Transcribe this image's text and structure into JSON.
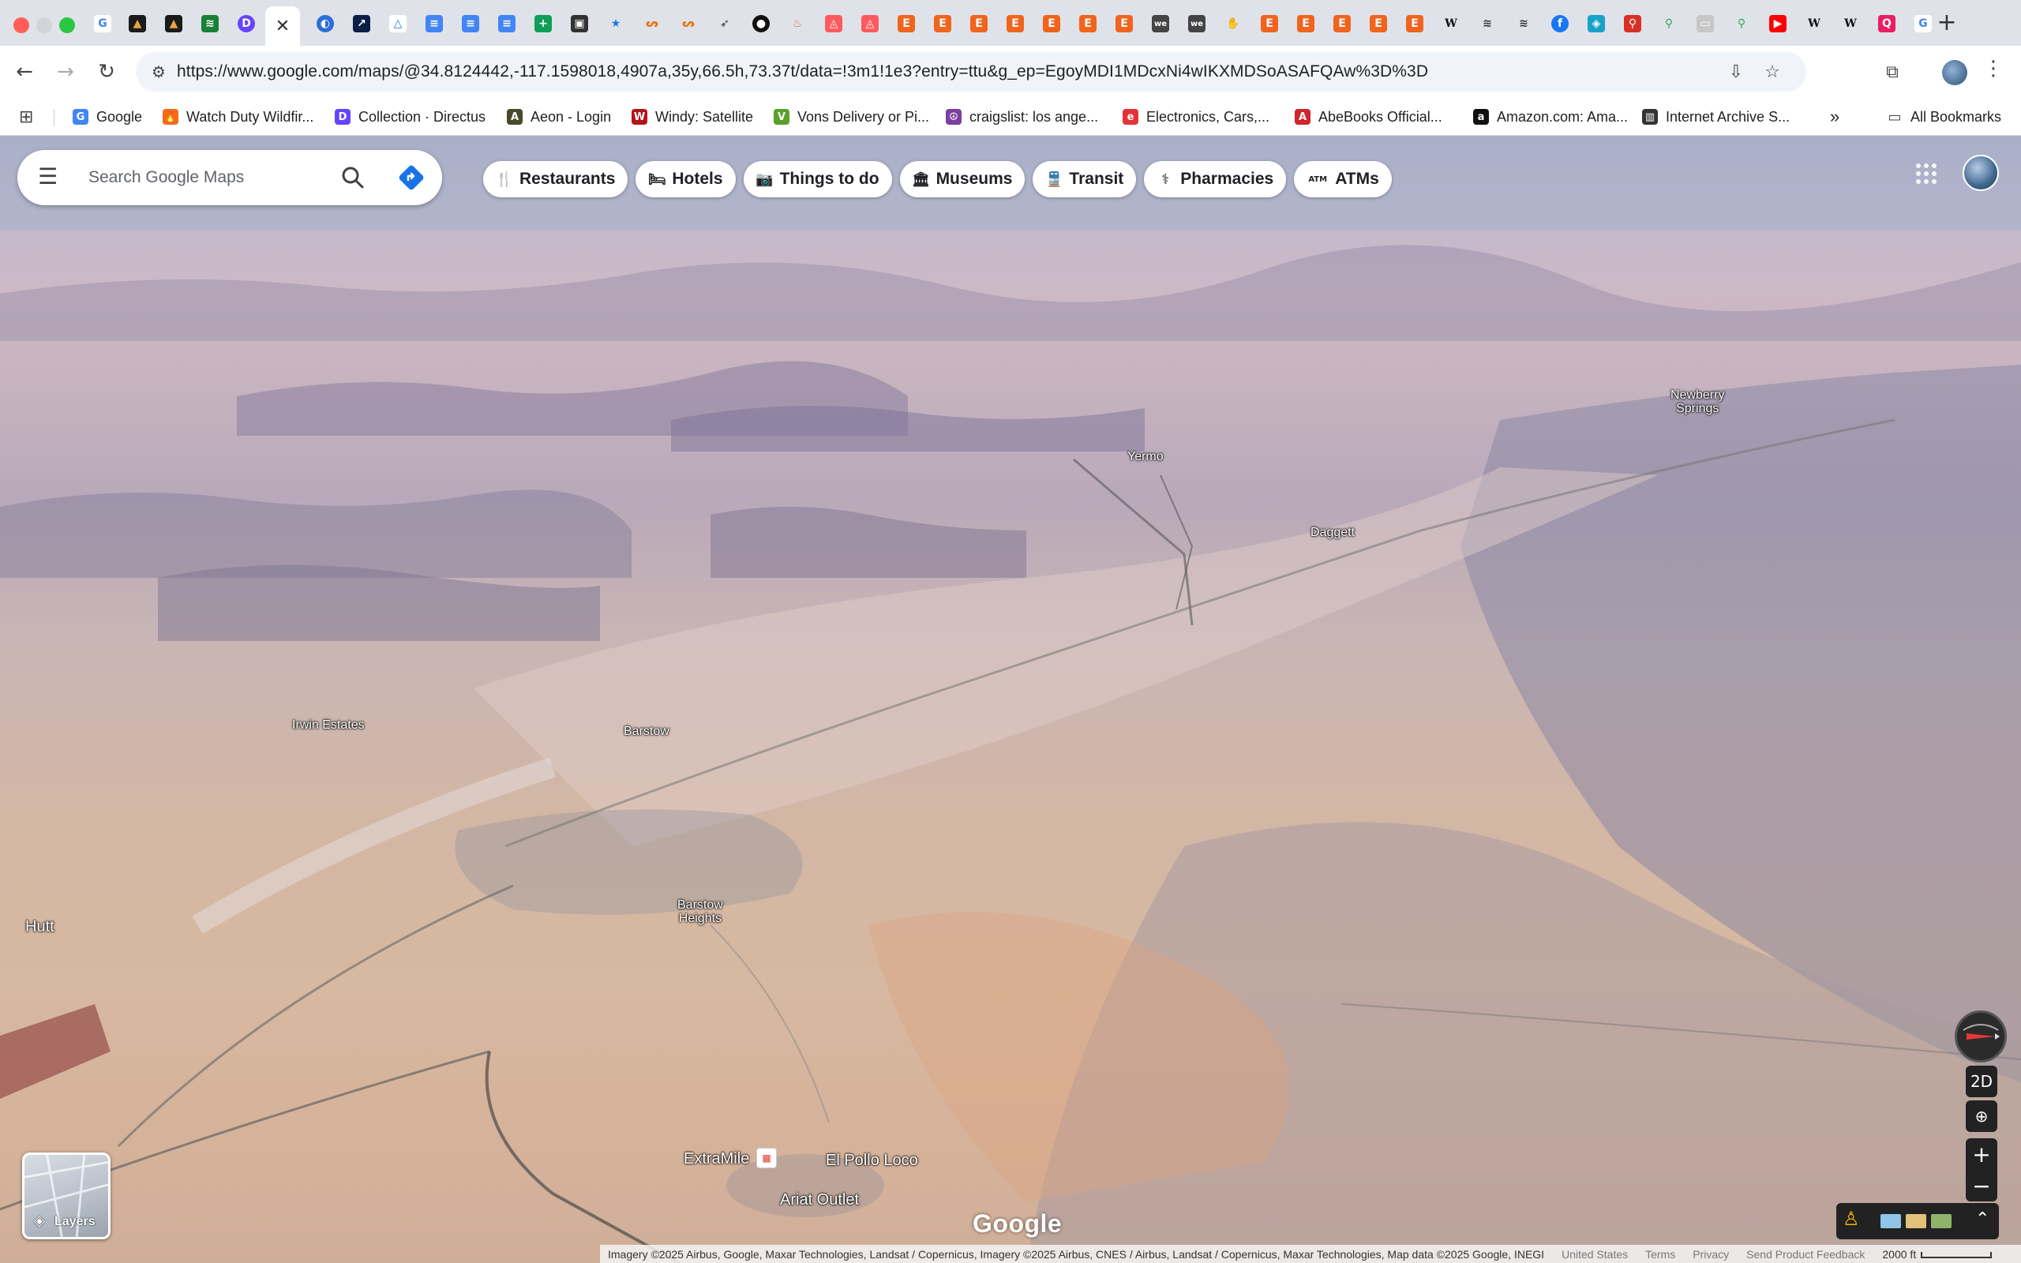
{
  "tabs": {
    "active_close_glyph": "✕",
    "new_tab_glyph": "+"
  },
  "toolbar": {
    "back_glyph": "←",
    "forward_glyph": "→",
    "reload_glyph": "↻",
    "url_host": "https://www.google.com",
    "url_path": "/maps/@34.8124442,-117.1598018,4907a,35y,66.5h,73.37t/data=!3m1!1e3?entry=ttu&g_ep=EgoyMDI1MDcxNi4wIKXMDSoASAFQAw%3D%3D",
    "kebab_glyph": "⋮"
  },
  "bookmarks": [
    {
      "label": "Google",
      "icon": "google-icon",
      "color": "#4285f4",
      "glyph": "G"
    },
    {
      "label": "Watch Duty Wildfir...",
      "icon": "flame-icon",
      "color": "#f26b1d",
      "glyph": "🔥"
    },
    {
      "label": "Collection · Directus",
      "icon": "directus-icon",
      "color": "#6644ff",
      "glyph": "D"
    },
    {
      "label": "Aeon - Login",
      "icon": "aeon-icon",
      "color": "#4a4a2a",
      "glyph": "A"
    },
    {
      "label": "Windy: Satellite",
      "icon": "windy-icon",
      "color": "#b3131b",
      "glyph": "W"
    },
    {
      "label": "Vons Delivery or Pi...",
      "icon": "vons-icon",
      "color": "#5aa02c",
      "glyph": "V"
    },
    {
      "label": "craigslist: los ange...",
      "icon": "peace-icon",
      "color": "#7b3fa0",
      "glyph": "☮"
    },
    {
      "label": "Electronics, Cars,...",
      "icon": "ebay-icon",
      "color": "#e53238",
      "glyph": "e"
    },
    {
      "label": "AbeBooks Official...",
      "icon": "abebooks-icon",
      "color": "#d0252c",
      "glyph": "A"
    },
    {
      "label": "Amazon.com: Ama...",
      "icon": "amazon-icon",
      "color": "#111111",
      "glyph": "a"
    },
    {
      "label": "Internet Archive S...",
      "icon": "archive-icon",
      "color": "#333333",
      "glyph": "▥"
    }
  ],
  "bookmarks_overflow_glyph": "»",
  "all_bookmarks_label": "All Bookmarks",
  "maps": {
    "search_placeholder": "Search Google Maps",
    "chips": [
      {
        "label": "Restaurants",
        "icon": "fork-knife-icon",
        "glyph": "🍴"
      },
      {
        "label": "Hotels",
        "icon": "bed-icon",
        "glyph": "🛏"
      },
      {
        "label": "Things to do",
        "icon": "camera-icon",
        "glyph": "📷"
      },
      {
        "label": "Museums",
        "icon": "museum-icon",
        "glyph": "🏛"
      },
      {
        "label": "Transit",
        "icon": "train-icon",
        "glyph": "🚆"
      },
      {
        "label": "Pharmacies",
        "icon": "pharmacy-icon",
        "glyph": "⚕"
      },
      {
        "label": "ATMs",
        "icon": "atm-icon",
        "glyph": "ATM"
      }
    ],
    "places": {
      "yermo": "Yermo",
      "daggett": "Daggett",
      "newberry_1": "Newberry",
      "newberry_2": "Springs",
      "irwin_estates": "Irwin Estates",
      "barstow": "Barstow",
      "barstow_heights_1": "Barstow",
      "barstow_heights_2": "Heights",
      "hutt": "Hutt",
      "extramile": "ExtraMile",
      "el_pollo_loco": "El Pollo Loco",
      "ariat_outlet": "Ariat Outlet"
    },
    "controls": {
      "toggle_2d": "2D",
      "zoom_in": "+",
      "zoom_out": "−",
      "expand_glyph": "⌃"
    },
    "layers_label": "Layers",
    "google_logo": "Google",
    "attribution": {
      "imagery": "Imagery ©2025 Airbus, Google, Maxar Technologies, Landsat / Copernicus, Imagery ©2025 Airbus, CNES / Airbus, Landsat / Copernicus, Maxar Technologies, Map data ©2025 Google, INEGI",
      "region": "United States",
      "terms": "Terms",
      "privacy": "Privacy",
      "feedback": "Send Product Feedback",
      "scale": "2000 ft"
    }
  }
}
